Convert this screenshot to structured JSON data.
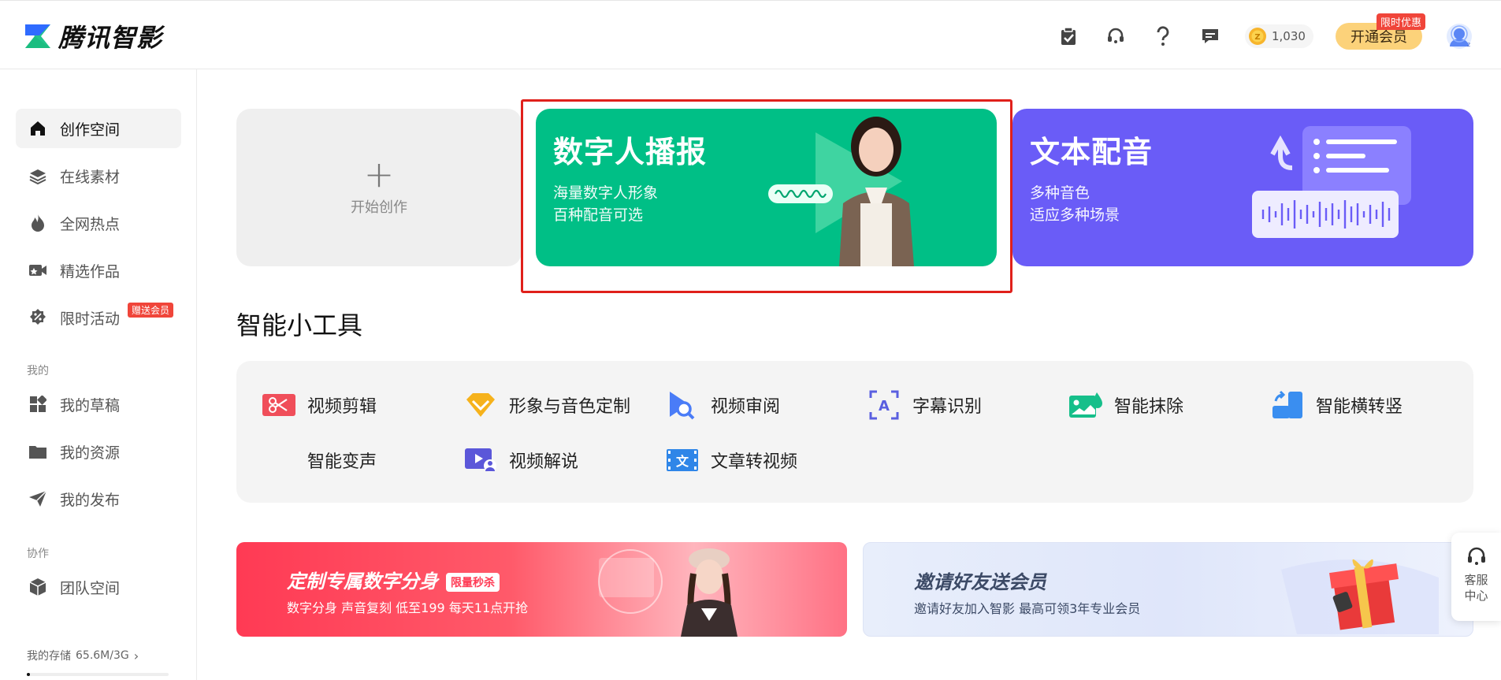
{
  "app": {
    "name": "腾讯智影",
    "brand_colors": {
      "green": "#00bf86",
      "purple": "#6a5cf7",
      "red": "#f0453a",
      "gold": "#fcd27a"
    }
  },
  "header": {
    "icons": [
      "clipboard-check-icon",
      "headset-icon",
      "help-icon",
      "message-icon"
    ],
    "coins": "1,030",
    "vip_button": "开通会员",
    "vip_badge": "限时优惠"
  },
  "sidebar": {
    "items": [
      {
        "label": "创作空间",
        "icon": "home-icon",
        "active": true
      },
      {
        "label": "在线素材",
        "icon": "layers-icon"
      },
      {
        "label": "全网热点",
        "icon": "fire-icon"
      },
      {
        "label": "精选作品",
        "icon": "video-camera-icon"
      },
      {
        "label": "限时活动",
        "icon": "badge-percent-icon",
        "badge": "赠送会员"
      }
    ],
    "section_mine": "我的",
    "mine_items": [
      {
        "label": "我的草稿",
        "icon": "grid-icon"
      },
      {
        "label": "我的资源",
        "icon": "folder-icon"
      },
      {
        "label": "我的发布",
        "icon": "send-icon"
      }
    ],
    "section_collab": "协作",
    "collab_items": [
      {
        "label": "团队空间",
        "icon": "cube-icon"
      }
    ],
    "storage_label": "我的存储",
    "storage_value": "65.6M/3G",
    "storage_fraction": 0.02
  },
  "cards": {
    "start": {
      "label": "开始创作"
    },
    "digital_human": {
      "title": "数字人播报",
      "line1": "海量数字人形象",
      "line2": "百种配音可选"
    },
    "text_voice": {
      "title": "文本配音",
      "line1": "多种音色",
      "line2": "适应多种场景"
    }
  },
  "tools_section": {
    "title": "智能小工具",
    "tools": [
      {
        "label": "视频剪辑",
        "icon": "scissors-icon"
      },
      {
        "label": "形象与音色定制",
        "icon": "diamond-icon"
      },
      {
        "label": "视频审阅",
        "icon": "review-search-icon"
      },
      {
        "label": "字幕识别",
        "icon": "subtitle-scan-icon"
      },
      {
        "label": "智能抹除",
        "icon": "image-erase-icon"
      },
      {
        "label": "智能横转竖",
        "icon": "rotate-screen-icon"
      },
      {
        "label": "智能变声",
        "icon": ""
      },
      {
        "label": "视频解说",
        "icon": "video-narration-icon"
      },
      {
        "label": "文章转视频",
        "icon": "article-to-video-icon"
      }
    ]
  },
  "banners": {
    "custom_avatar": {
      "title": "定制专属数字分身",
      "tag": "限量秒杀",
      "subtitle": "数字分身 声音复刻 低至199 每天11点开抢"
    },
    "invite": {
      "title": "邀请好友送会员",
      "subtitle": "邀请好友加入智影 最高可领3年专业会员"
    }
  },
  "service": {
    "label": "客服中心"
  }
}
